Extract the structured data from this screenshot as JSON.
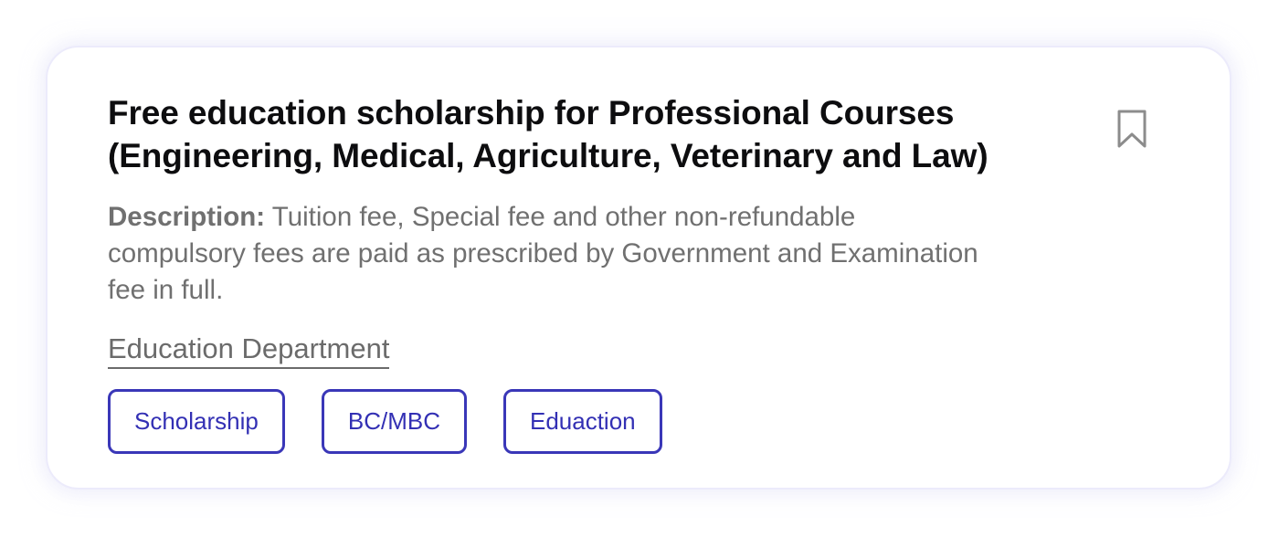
{
  "card": {
    "title": "Free education scholarship for Professional Courses (Engineering, Medical, Agriculture, Veterinary and Law)",
    "bookmark_icon": "bookmark-outline-icon",
    "description_label": "Description:",
    "description_text": "Tuition fee, Special fee and other non-refundable compulsory fees are paid as prescribed by Government and Examination fee in full.",
    "department": "Education Department",
    "tags": [
      {
        "label": "Scholarship"
      },
      {
        "label": "BC/MBC"
      },
      {
        "label": "Eduaction"
      }
    ]
  },
  "colors": {
    "tag_accent": "#3a37b8",
    "title": "#0d0d0f",
    "muted_text": "#707070",
    "card_border": "#ecebfb"
  }
}
